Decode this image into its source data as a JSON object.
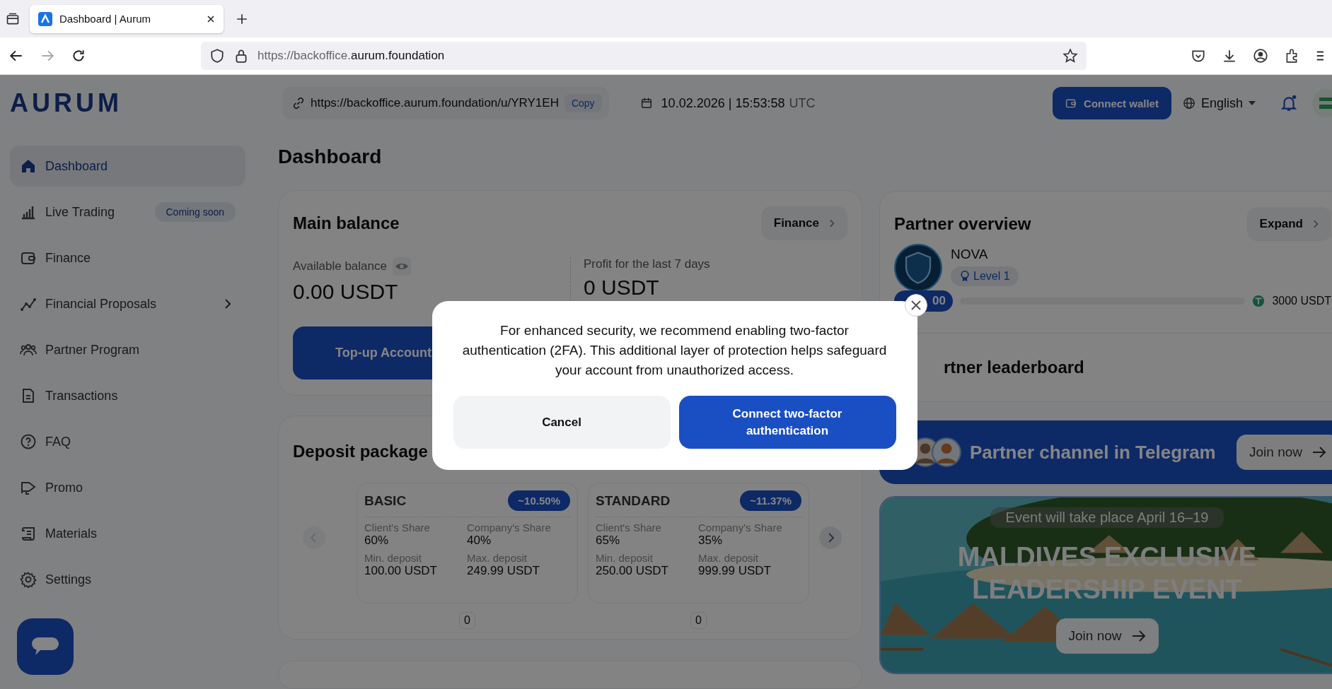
{
  "browser": {
    "tab_title": "Dashboard | Aurum",
    "url_prefix": "https://backoffice.",
    "url_domain": "aurum.foundation"
  },
  "header": {
    "logo": "AURUM",
    "referral_link": "https://backoffice.aurum.foundation/u/YRY1EH",
    "copy": "Copy",
    "datetime": "10.02.2026 | 15:53:58",
    "timezone": "UTC",
    "connect_wallet": "Connect wallet",
    "language": "English"
  },
  "sidebar": {
    "items": [
      {
        "label": "Dashboard",
        "selected": true,
        "submenu": false
      },
      {
        "label": "Live Trading",
        "selected": false,
        "submenu": false,
        "badge": "Coming soon"
      },
      {
        "label": "Finance",
        "selected": false,
        "submenu": false
      },
      {
        "label": "Financial Proposals",
        "selected": false,
        "submenu": true
      },
      {
        "label": "Partner Program",
        "selected": false,
        "submenu": false
      },
      {
        "label": "Transactions",
        "selected": false,
        "submenu": false
      },
      {
        "label": "FAQ",
        "selected": false,
        "submenu": false
      },
      {
        "label": "Promo",
        "selected": false,
        "submenu": false
      },
      {
        "label": "Materials",
        "selected": false,
        "submenu": false
      },
      {
        "label": "Settings",
        "selected": false,
        "submenu": false
      }
    ]
  },
  "page_title": "Dashboard",
  "main_balance": {
    "title": "Main balance",
    "finance_button": "Finance",
    "available_label": "Available balance",
    "available_value": "0.00 USDT",
    "profit_label": "Profit for the last 7 days",
    "profit_value": "0 USDT",
    "topup_button": "Top-up Account"
  },
  "deposit_packages": {
    "title": "Deposit package",
    "packages": [
      {
        "name": "BASIC",
        "rate": "~10.50%",
        "client_share_label": "Client's Share",
        "client_share": "60%",
        "company_share_label": "Company's Share",
        "company_share": "40%",
        "min_label": "Min. deposit",
        "min": "100.00 USDT",
        "max_label": "Max. deposit",
        "max": "249.99 USDT",
        "count": "0"
      },
      {
        "name": "STANDARD",
        "rate": "~11.37%",
        "client_share_label": "Client's Share",
        "client_share": "65%",
        "company_share_label": "Company's Share",
        "company_share": "35%",
        "min_label": "Min. deposit",
        "min": "250.00 USDT",
        "max_label": "Max. deposit",
        "max": "999.99 USDT",
        "count": "0"
      }
    ]
  },
  "partner_overview": {
    "title": "Partner overview",
    "expand_button": "Expand",
    "rank": "NOVA",
    "level": "Level 1",
    "progress_start": "00",
    "progress_target": "3000 USDT",
    "leaderboard_title": "rtner leaderboard"
  },
  "telegram": {
    "title": "Partner channel in Telegram",
    "join_button": "Join now"
  },
  "event": {
    "date": "Event will take place April 16–19",
    "title": "MALDIVES EXCLUSIVE LEADERSHIP EVENT",
    "join_button": "Join now"
  },
  "modal": {
    "message": "For enhanced security, we recommend enabling two-factor authentication (2FA). This additional layer of protection helps safeguard your account from unauthorized access.",
    "cancel_button": "Cancel",
    "confirm_button": "Connect two-factor authentication"
  }
}
